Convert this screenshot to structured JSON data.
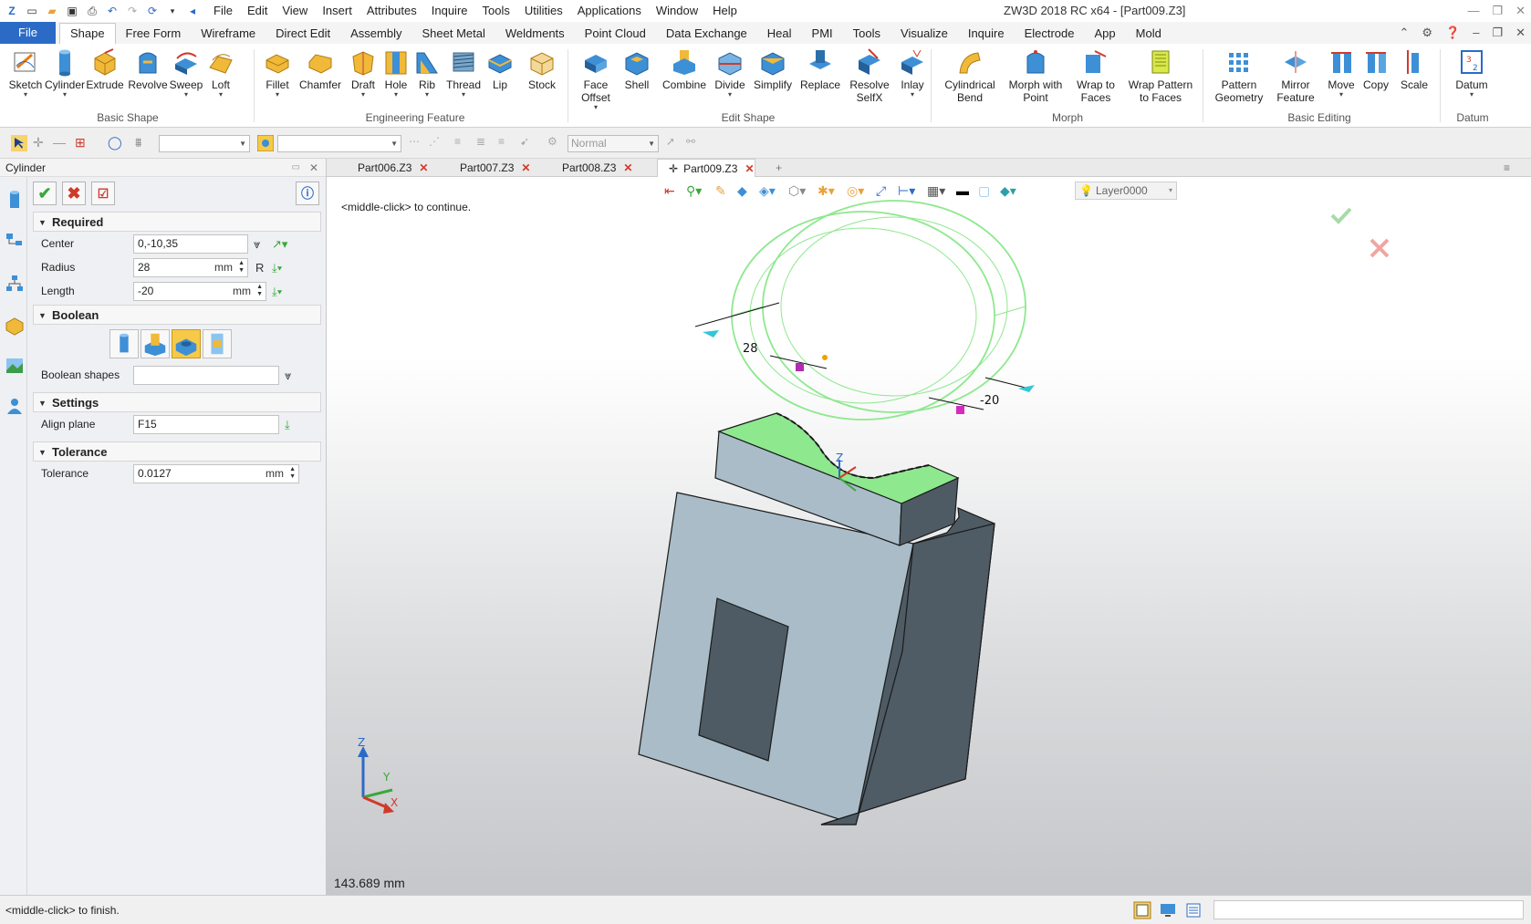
{
  "titlebar": {
    "title": "ZW3D 2018 RC x64 - [Part009.Z3]",
    "menus": [
      "File",
      "Edit",
      "View",
      "Insert",
      "Attributes",
      "Inquire",
      "Tools",
      "Utilities",
      "Applications",
      "Window",
      "Help"
    ]
  },
  "ribbon_tabs": [
    "File",
    "Shape",
    "Free Form",
    "Wireframe",
    "Direct Edit",
    "Assembly",
    "Sheet Metal",
    "Weldments",
    "Point Cloud",
    "Data Exchange",
    "Heal",
    "PMI",
    "Tools",
    "Visualize",
    "Inquire",
    "Electrode",
    "App",
    "Mold"
  ],
  "active_ribbon_tab": "Shape",
  "ribbon": {
    "basic_shape": {
      "label": "Basic Shape",
      "buttons": [
        "Sketch",
        "Cylinder",
        "Extrude",
        "Revolve",
        "Sweep",
        "Loft"
      ]
    },
    "engineering_feature": {
      "label": "Engineering Feature",
      "buttons": [
        "Fillet",
        "Chamfer",
        "Draft",
        "Hole",
        "Rib",
        "Thread",
        "Lip",
        "Stock"
      ]
    },
    "edit_shape": {
      "label": "Edit Shape",
      "buttons": [
        "Face Offset",
        "Shell",
        "Combine",
        "Divide",
        "Simplify",
        "Replace",
        "Resolve SelfX",
        "Inlay"
      ]
    },
    "morph": {
      "label": "Morph",
      "buttons": [
        "Cylindrical Bend",
        "Morph with Point",
        "Wrap to Faces",
        "Wrap Pattern to Faces"
      ]
    },
    "basic_editing": {
      "label": "Basic Editing",
      "buttons": [
        "Pattern Geometry",
        "Mirror Feature",
        "Move",
        "Copy",
        "Scale"
      ]
    },
    "datum": {
      "label": "Datum",
      "buttons": [
        "Datum"
      ]
    }
  },
  "toolbar2": {
    "render_mode": "Normal"
  },
  "panel": {
    "title": "Cylinder",
    "required": {
      "header": "Required",
      "center_label": "Center",
      "center_value": "0,-10,35",
      "radius_label": "Radius",
      "radius_value": "28",
      "radius_unit": "mm",
      "radius_suffix": "R",
      "length_label": "Length",
      "length_value": "-20",
      "length_unit": "mm"
    },
    "boolean": {
      "header": "Boolean",
      "shapes_label": "Boolean shapes",
      "shapes_value": ""
    },
    "settings": {
      "header": "Settings",
      "align_label": "Align plane",
      "align_value": "F15"
    },
    "tolerance": {
      "header": "Tolerance",
      "tolerance_label": "Tolerance",
      "tolerance_value": "0.0127",
      "tolerance_unit": "mm"
    }
  },
  "doc_tabs": [
    "Part006.Z3",
    "Part007.Z3",
    "Part008.Z3",
    "Part009.Z3"
  ],
  "active_doc_tab": "Part009.Z3",
  "viewport": {
    "prompt": "<middle-click> to continue.",
    "layer": "Layer0000",
    "dim_radius": "28",
    "dim_length": "-20",
    "axis_labels": {
      "z": "Z",
      "y": "Y",
      "x": "X"
    },
    "measure": "143.689 mm"
  },
  "status": {
    "message": "<middle-click> to finish."
  },
  "colors": {
    "accent": "#2b6bc6",
    "preview_green": "#8ee88e",
    "body_light": "#a9bcc8",
    "body_dark": "#4e5b64"
  }
}
